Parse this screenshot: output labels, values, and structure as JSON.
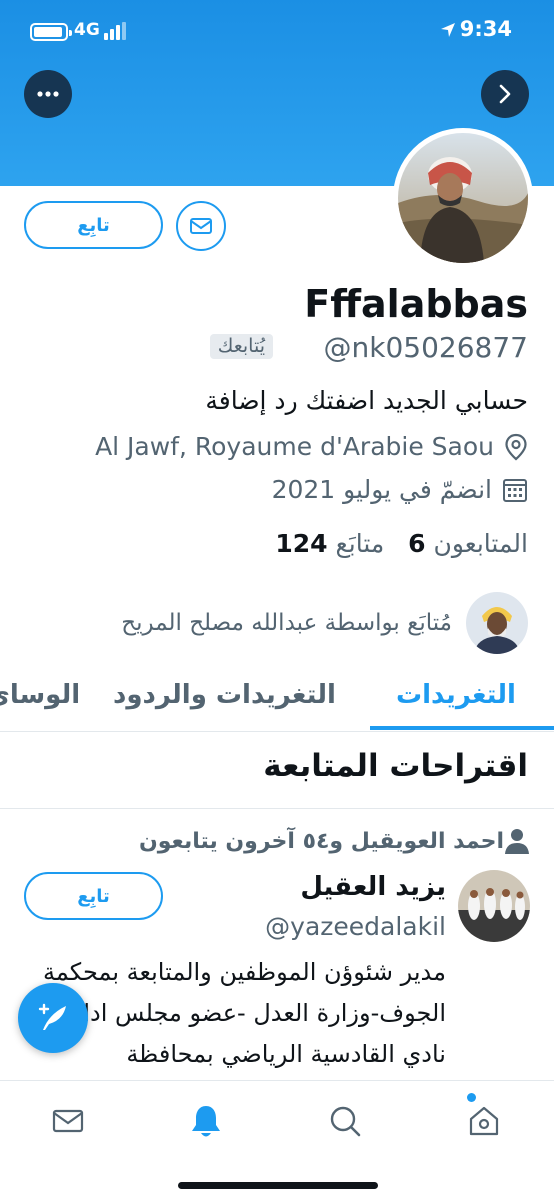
{
  "status_bar": {
    "network": "4G",
    "time": "9:34"
  },
  "header": {
    "more_icon": "ellipsis-icon",
    "next_icon": "chevron-right-icon",
    "accent": "#1d9bf0"
  },
  "profile": {
    "display_name": "Fffalabbas",
    "handle": "@nk05026877",
    "follows_you_badge": "يُتابعك",
    "bio": "حسابي الجديد اضفتك رد إضافة",
    "location": "Al Jawf, Royaume d'Arabie Saou",
    "joined": "انضمّ في يوليو 2021",
    "following_count": "124",
    "following_label": "متابَع",
    "followers_count": "6",
    "followers_label": "المتابعون",
    "follow_button": "تابِع",
    "followed_by": "مُتابَع بواسطة عبدالله مصلح المريح"
  },
  "tabs": [
    {
      "label": "التغريدات",
      "active": true
    },
    {
      "label": "التغريدات والردود",
      "active": false
    },
    {
      "label": "الوسائ",
      "active": false
    }
  ],
  "suggestions": {
    "title": "اقتراحات المتابعة",
    "items": [
      {
        "context": "احمد العويقيل و٥٤ آخرون يتابعون",
        "name": "يزيد العقيل",
        "handle": "@yazeedalakil",
        "bio": "مدير شئوؤن الموظفين والمتابعة بمحكمة الجوف-وزارة العدل -عضو مجلس ادارة نادي القادسية الرياضي بمحافظة",
        "follow_button": "تابِع"
      }
    ]
  },
  "bottom_nav": [
    "mail-icon",
    "bell-icon",
    "search-icon",
    "home-icon"
  ]
}
